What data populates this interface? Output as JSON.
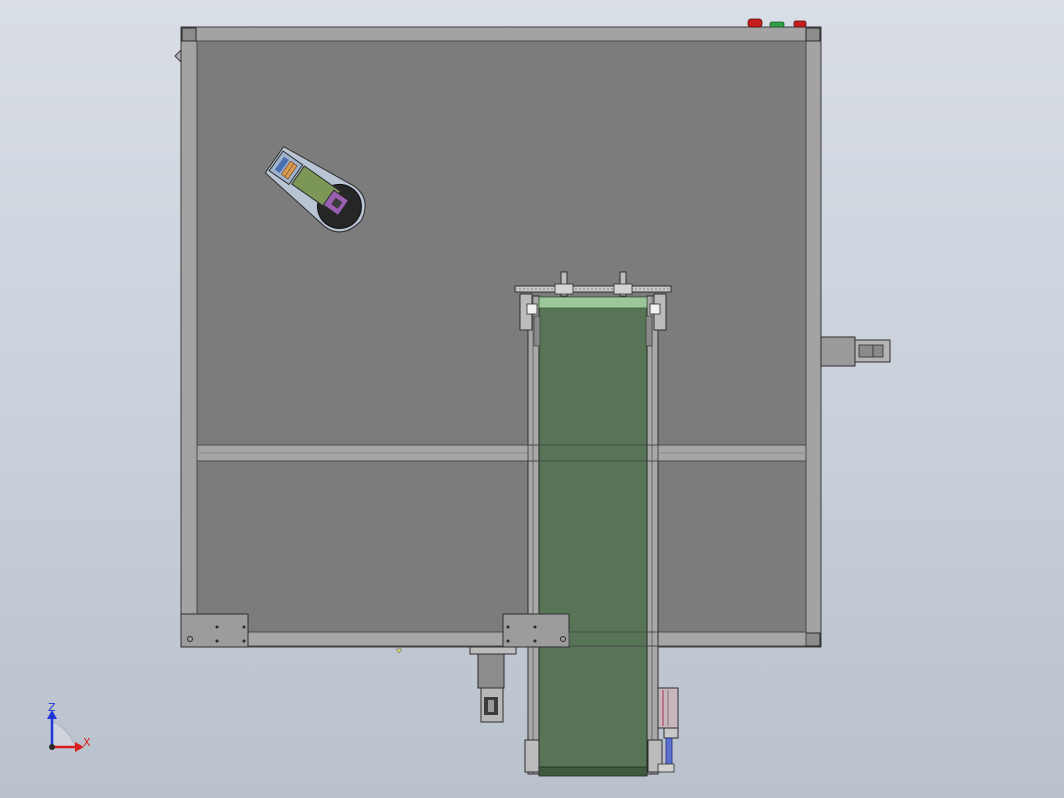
{
  "viewport": {
    "background_top": "#d9dee6",
    "background_bottom": "#b9c1cd"
  },
  "model": {
    "frame_color": "#9c9c9c",
    "table_top_color": "#7a7a7a",
    "belt_color": "#577556",
    "belt_edge_color": "#9cc79a",
    "robot_base_color": "#262626",
    "robot_link_color": "#7b9657",
    "robot_joint_color": "#9a5fb0",
    "gripper_color": "#9fb3cc",
    "estop_color": "#c81d1d",
    "start_button_color": "#2ea043"
  },
  "triad": {
    "axis_z_label": "Z",
    "axis_x_label": "X",
    "z_color": "#1f35d9",
    "x_color": "#d92020"
  }
}
